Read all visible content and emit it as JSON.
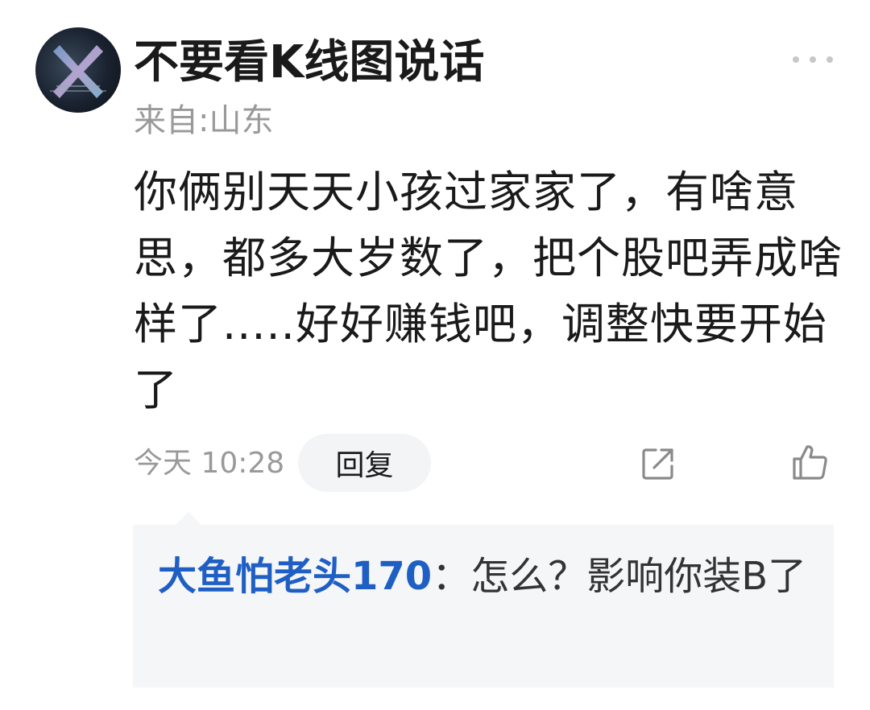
{
  "comment": {
    "username": "不要看K线图说话",
    "location": "来自:山东",
    "content": "你俩别天天小孩过家家了，有啥意思，都多大岁数了，把个股吧弄成啥样了.....好好赚钱吧，调整快要开始了",
    "time": "今天 10:28",
    "reply_label": "回复",
    "icons": {
      "more": "more-dots-icon",
      "share": "share-icon",
      "like": "thumbs-up-icon"
    }
  },
  "sub_reply": {
    "author": "大鱼怕老头170",
    "separator": "：",
    "text": "怎么？影响你装B了"
  },
  "colors": {
    "author_link": "#1f5fc4",
    "muted_text": "#999999",
    "reply_background": "#f5f6f8"
  }
}
